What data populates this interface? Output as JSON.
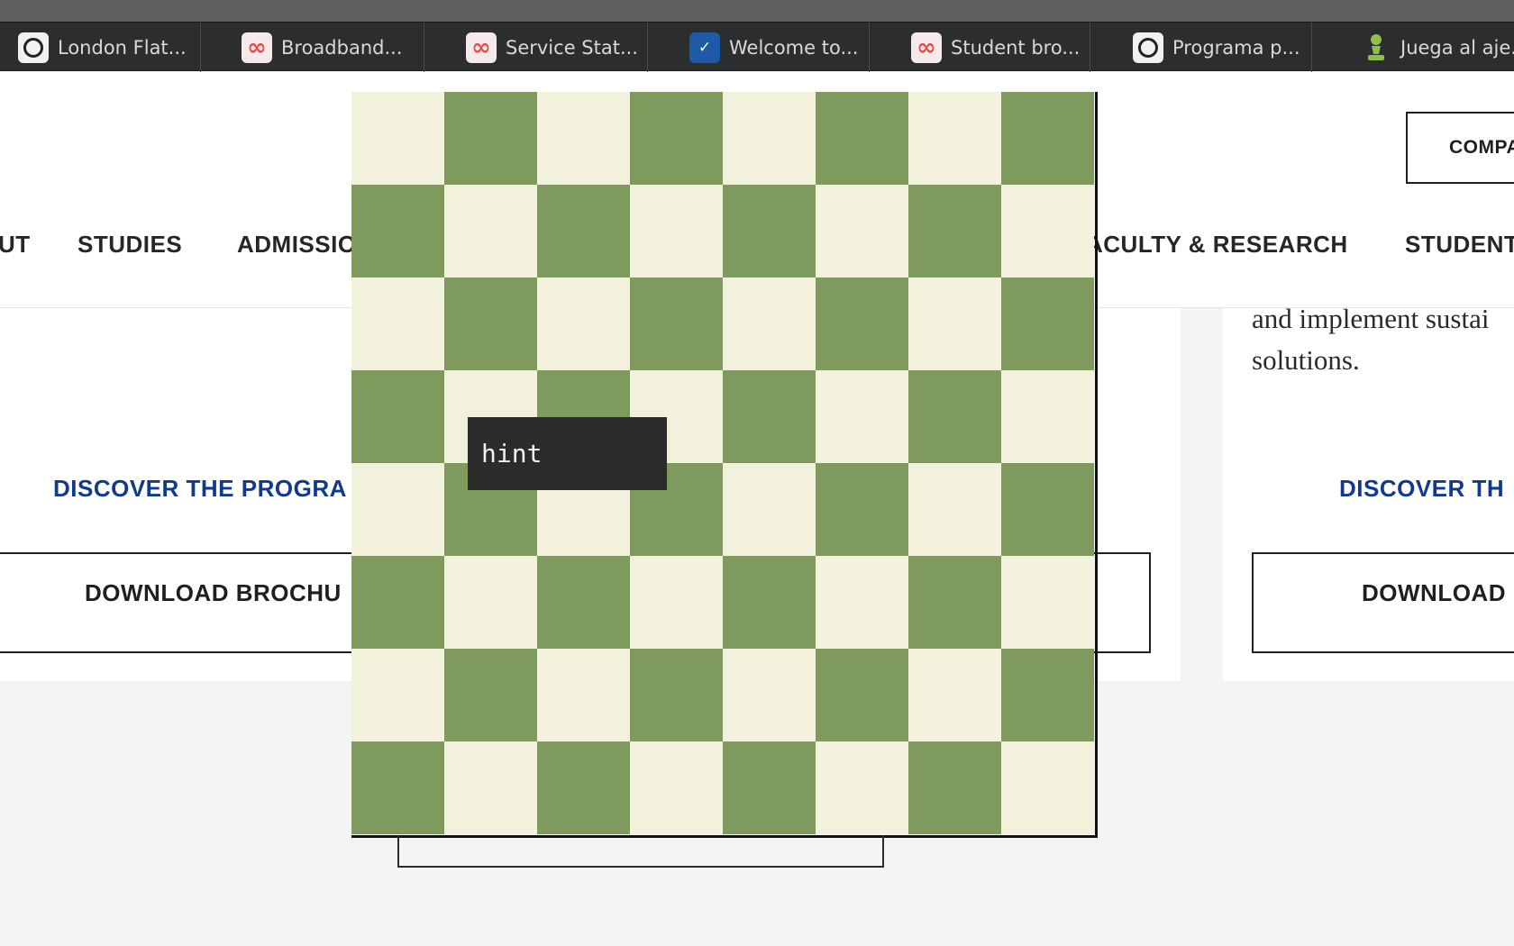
{
  "browser": {
    "tabs": [
      {
        "title": "London Flat...",
        "icon": "openai-icon"
      },
      {
        "title": "Broadband...",
        "icon": "infinity-icon"
      },
      {
        "title": "Service Stat...",
        "icon": "infinity-icon"
      },
      {
        "title": "Welcome to...",
        "icon": "welcome-app-icon"
      },
      {
        "title": "Student bro...",
        "icon": "infinity-icon"
      },
      {
        "title": "Programa p...",
        "icon": "openai-icon"
      },
      {
        "title": "Juega al aje...",
        "icon": "chess-pawn-icon"
      }
    ]
  },
  "header": {
    "compare_label": "COMPARE",
    "nav": {
      "about": "UT",
      "studies": "STUDIES",
      "admissions": "ADMISSIO",
      "faculty": "ACULTY & RESEARCH",
      "student": "STUDENT"
    }
  },
  "cards": {
    "right_text_line1": "and implement sustai",
    "right_text_line2": "solutions.",
    "left_discover": "DISCOVER THE PROGRA",
    "right_discover": "DISCOVER TH",
    "left_download": "DOWNLOAD BROCHU",
    "right_download": "DOWNLOAD"
  },
  "chess": {
    "hint_label": "hint",
    "colors": {
      "light": "#f2f2dc",
      "dark": "#7f9a5d"
    }
  }
}
